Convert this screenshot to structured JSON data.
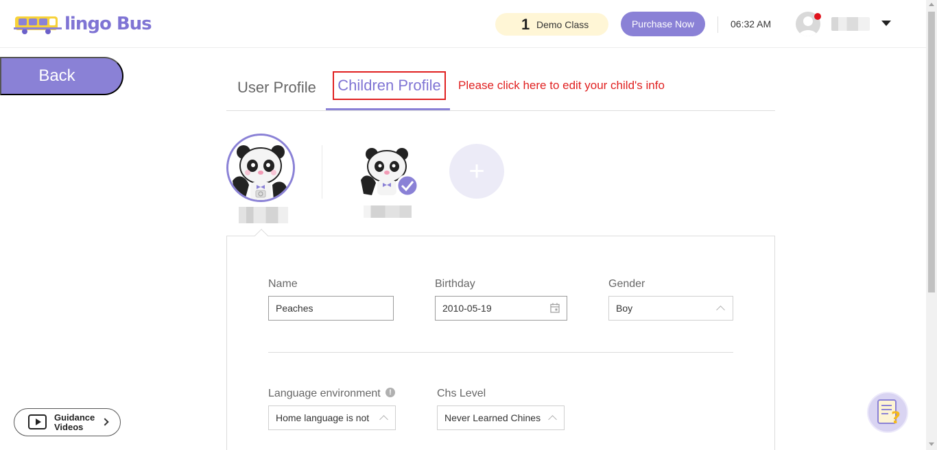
{
  "header": {
    "brand": "lingo Bus",
    "demo_count": "1",
    "demo_label": "Demo Class",
    "purchase_label": "Purchase Now",
    "time": "06:32 AM"
  },
  "nav": {
    "back_label": "Back"
  },
  "tabs": [
    {
      "label": "User Profile",
      "active": false
    },
    {
      "label": "Children Profile",
      "active": true
    }
  ],
  "hint_text": "Please click here to edit your child's info",
  "add_child_symbol": "+",
  "form": {
    "name_label": "Name",
    "name_value": "Peaches",
    "birthday_label": "Birthday",
    "birthday_value": "2010-05-19",
    "gender_label": "Gender",
    "gender_value": "Boy",
    "lang_env_label": "Language environment",
    "lang_env_value": "Home language is not",
    "chs_level_label": "Chs Level",
    "chs_level_value": "Never Learned Chines"
  },
  "guidance": {
    "line1": "Guidance",
    "line2": "Videos"
  },
  "colors": {
    "brand_purple": "#8a81d6",
    "highlight_red": "#e01f1f",
    "demo_pill_bg": "#fff6d6",
    "notification_red": "#e0121c"
  }
}
